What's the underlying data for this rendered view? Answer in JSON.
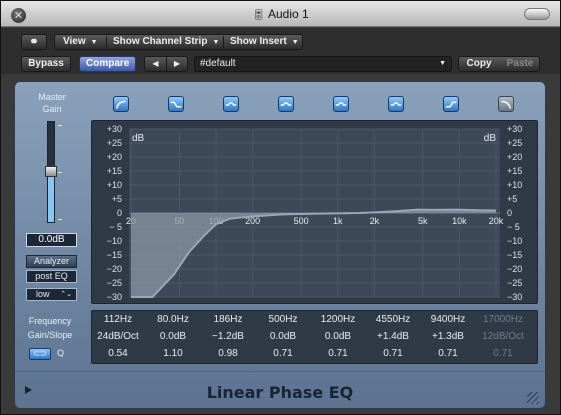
{
  "window": {
    "title": "Audio 1",
    "close_symbol": "✕",
    "title_icon": "🎚"
  },
  "toolbar": {
    "link_symbol": "⚭",
    "view_label": "View",
    "show_channel_strip_label": "Show Channel Strip",
    "show_insert_label": "Show Insert",
    "menu_arrow": "▼",
    "bypass_label": "Bypass",
    "compare_label": "Compare",
    "prev_symbol": "◀",
    "next_symbol": "▶",
    "preset_value": "#default",
    "copy_label": "Copy",
    "paste_label": "Paste"
  },
  "left_panel": {
    "master_gain_label": "Master\nGain",
    "master_gain_level": 0.5,
    "master_gain_value": "0.0dB",
    "analyzer_label": "Analyzer",
    "post_eq_label": "post EQ",
    "resolution_value": "low",
    "resolution_arrows": "⌃⌄",
    "frequency_label": "Frequency",
    "gain_slope_label": "Gain/Slope",
    "q_label": "Q",
    "link_chip_symbol": "⊂⊃"
  },
  "bands": [
    {
      "icon": "low-cut-icon",
      "enabled": true
    },
    {
      "icon": "low-shelf-icon",
      "enabled": true
    },
    {
      "icon": "parametric-bell-icon",
      "enabled": true
    },
    {
      "icon": "parametric-bell-icon",
      "enabled": true
    },
    {
      "icon": "parametric-bell-icon",
      "enabled": true
    },
    {
      "icon": "parametric-bell-icon",
      "enabled": true
    },
    {
      "icon": "high-shelf-icon",
      "enabled": true
    },
    {
      "icon": "high-cut-icon",
      "enabled": false
    }
  ],
  "graph": {
    "db_label": "dB",
    "y_ticks": [
      "+30",
      "+25",
      "+20",
      "+15",
      "+10",
      "+5",
      "0",
      "− 5",
      "−10",
      "−15",
      "−20",
      "−25",
      "−30"
    ],
    "x_ticks": [
      "20",
      "50",
      "100",
      "200",
      "500",
      "1k",
      "2k",
      "5k",
      "10k",
      "20k"
    ],
    "curve_color": "#9aa7b6",
    "fill_color": "#8c97a4"
  },
  "params": [
    {
      "freq": "112Hz",
      "gain": "24dB/Oct",
      "q": "0.54",
      "enabled": true
    },
    {
      "freq": "80.0Hz",
      "gain": "0.0dB",
      "q": "1.10",
      "enabled": true
    },
    {
      "freq": "186Hz",
      "gain": "−1.2dB",
      "q": "0.98",
      "enabled": true
    },
    {
      "freq": "500Hz",
      "gain": "0.0dB",
      "q": "0.71",
      "enabled": true
    },
    {
      "freq": "1200Hz",
      "gain": "0.0dB",
      "q": "0.71",
      "enabled": true
    },
    {
      "freq": "4550Hz",
      "gain": "+1.4dB",
      "q": "0.71",
      "enabled": true
    },
    {
      "freq": "9400Hz",
      "gain": "+1.3dB",
      "q": "0.71",
      "enabled": true
    },
    {
      "freq": "17000Hz",
      "gain": "12dB/Oct",
      "q": "0.71",
      "enabled": false
    }
  ],
  "footer": {
    "plugin_name": "Linear Phase EQ"
  },
  "colors": {
    "accent_blue": "#3a58a8",
    "panel_blue": "#7088a5"
  }
}
